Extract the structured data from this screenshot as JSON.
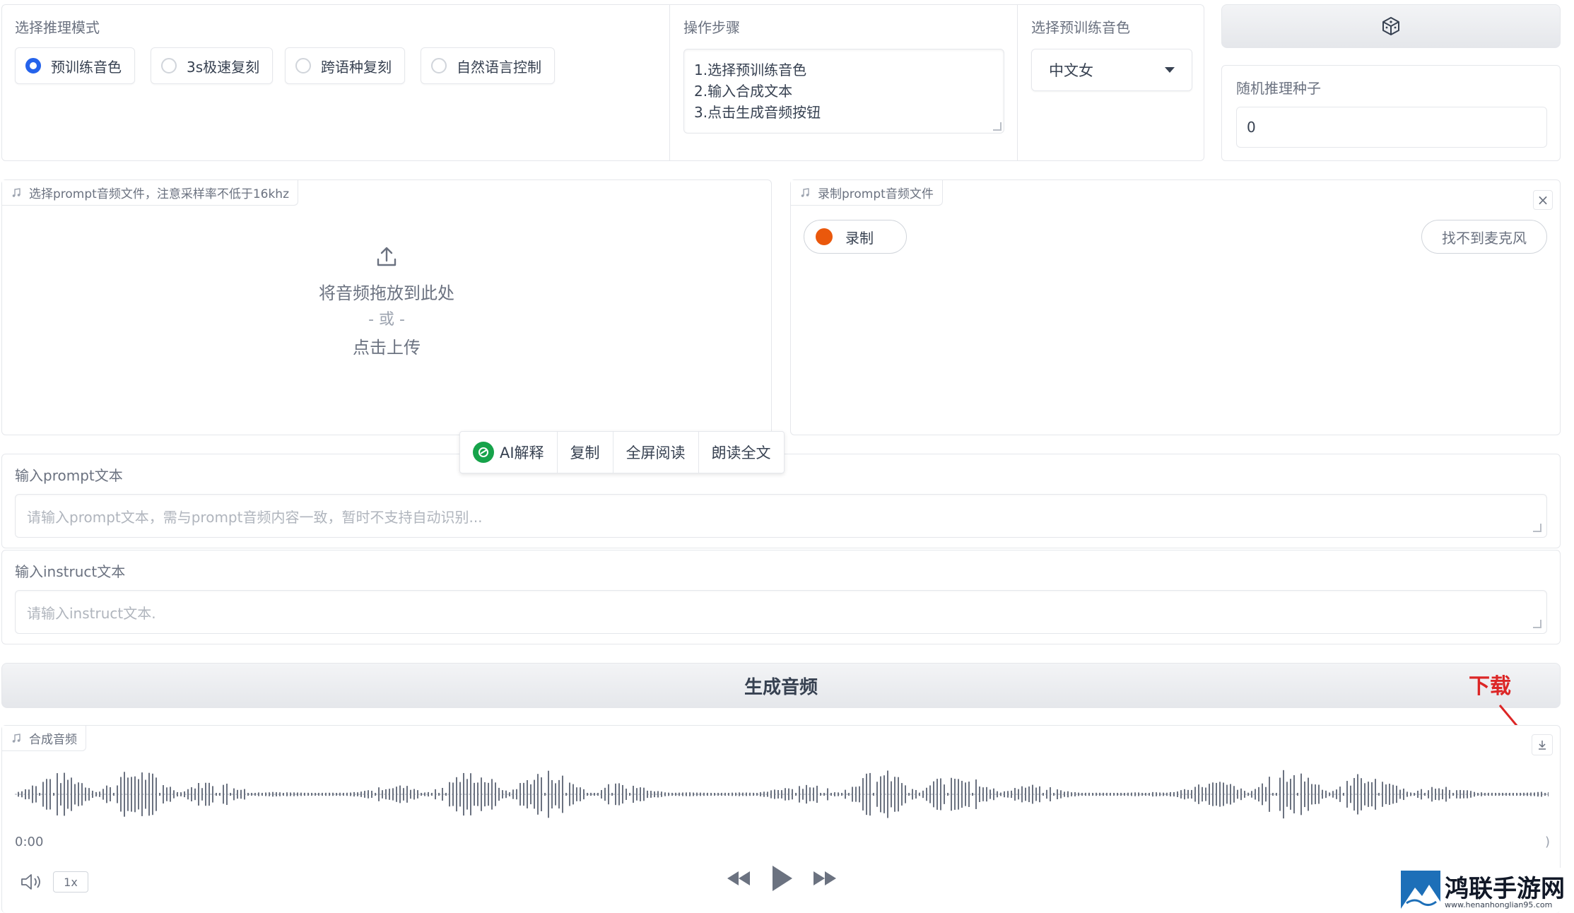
{
  "mode": {
    "label": "选择推理模式",
    "options": [
      "预训练音色",
      "3s极速复刻",
      "跨语种复刻",
      "自然语言控制"
    ],
    "selected": "预训练音色"
  },
  "steps": {
    "label": "操作步骤",
    "lines": [
      "1.选择预训练音色",
      "2.输入合成文本",
      "3.点击生成音频按钮"
    ]
  },
  "voice": {
    "label": "选择预训练音色",
    "value": "中文女"
  },
  "seed": {
    "label": "随机推理种子",
    "value": "0"
  },
  "upload": {
    "tag": "选择prompt音频文件，注意采样率不低于16khz",
    "drop_text": "将音频拖放到此处",
    "or_text": "- 或 -",
    "click_text": "点击上传"
  },
  "record": {
    "tag": "录制prompt音频文件",
    "close": "×",
    "record_label": "录制",
    "no_mic_label": "找不到麦克风"
  },
  "float_toolbar": {
    "ai_label": "AI解释",
    "copy_label": "复制",
    "fullscreen_label": "全屏阅读",
    "read_label": "朗读全文"
  },
  "prompt_text": {
    "label": "输入prompt文本",
    "placeholder": "请输入prompt文本，需与prompt音频内容一致，暂时不支持自动识别..."
  },
  "instruct_text": {
    "label": "输入instruct文本",
    "placeholder": "请输入instruct文本."
  },
  "generate": {
    "label": "生成音频"
  },
  "annotation": {
    "text": "下载",
    "color": "#dc2626"
  },
  "audio": {
    "tag": "合成音频",
    "time_current": "0:00",
    "time_end": ")",
    "speed": "1x"
  },
  "watermark": {
    "name": "鸿联手游网",
    "url": "www.henanhonglian95.com"
  },
  "colors": {
    "accent": "#2563eb",
    "record_dot": "#ea580c",
    "ai_logo": "#16a34a"
  }
}
